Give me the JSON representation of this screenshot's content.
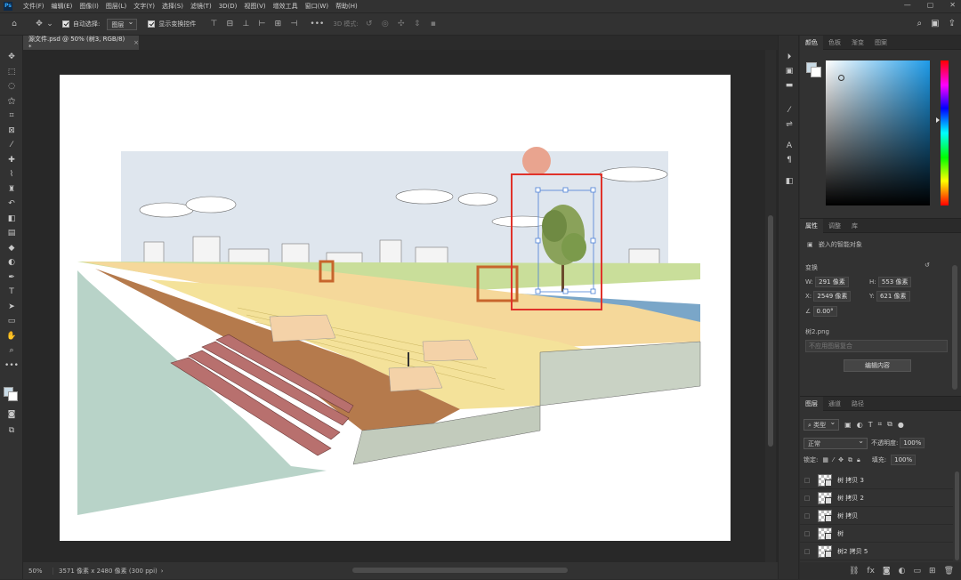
{
  "menubar": {
    "logo": "Ps",
    "items": [
      "文件(F)",
      "编辑(E)",
      "图像(I)",
      "图层(L)",
      "文字(Y)",
      "选择(S)",
      "滤镜(T)",
      "3D(D)",
      "视图(V)",
      "增效工具",
      "窗口(W)",
      "帮助(H)"
    ],
    "window_controls": [
      "—",
      "▢",
      "✕"
    ]
  },
  "options": {
    "auto_select_label": "自动选择:",
    "auto_select_value": "图层",
    "show_transform_label": "显示变换控件",
    "mode_3d_label": "3D 模式:"
  },
  "document": {
    "tab_title": "源文件.psd @ 50% (树3, RGB/8) *",
    "tab_close": "×"
  },
  "status": {
    "zoom": "50%",
    "info": "3571 像素 x 2480 像素 (300 ppi)",
    "arrow": "›"
  },
  "color_panel": {
    "tabs": [
      "颜色",
      "色板",
      "渐变",
      "图案"
    ],
    "fg_color": "#c9dbe6",
    "bg_color": "#ffffff",
    "hue_color": "#1e9be8"
  },
  "properties_panel": {
    "tabs": [
      "属性",
      "调整",
      "库"
    ],
    "object_type": "嵌入的智能对象",
    "section_transform": "变换",
    "w_label": "W:",
    "w_value": "291 像素",
    "h_label": "H:",
    "h_value": "553 像素",
    "x_label": "X:",
    "x_value": "2549 像素",
    "y_label": "Y:",
    "y_value": "621 像素",
    "angle_value": "0.00°",
    "file_name": "树2.png",
    "comp_label": "不应用图层复合",
    "edit_button": "编辑内容"
  },
  "layers_panel": {
    "tabs": [
      "图层",
      "通道",
      "路径"
    ],
    "filter_label": "类型",
    "blend_mode": "正常",
    "opacity_label": "不透明度:",
    "opacity_value": "100%",
    "lock_label": "锁定:",
    "fill_label": "填充:",
    "fill_value": "100%",
    "layers": [
      {
        "name": "树 拷贝 3"
      },
      {
        "name": "树 拷贝 2"
      },
      {
        "name": "树 拷贝"
      },
      {
        "name": "树"
      },
      {
        "name": "树2 拷贝 5"
      }
    ],
    "footer_icons": [
      "link-icon",
      "fx-icon",
      "mask-icon",
      "adjustment-icon",
      "group-icon",
      "new-layer-icon",
      "trash-icon"
    ]
  },
  "colors": {
    "sky": "#dfe6ee",
    "selection_red": "#e0322a",
    "sun": "#e9a48f",
    "water": "#b8d3c8",
    "grass": "#c9de9a",
    "wood": "#b57a4c",
    "steps": "#f4e29a",
    "stairs_red": "#b8706e"
  }
}
